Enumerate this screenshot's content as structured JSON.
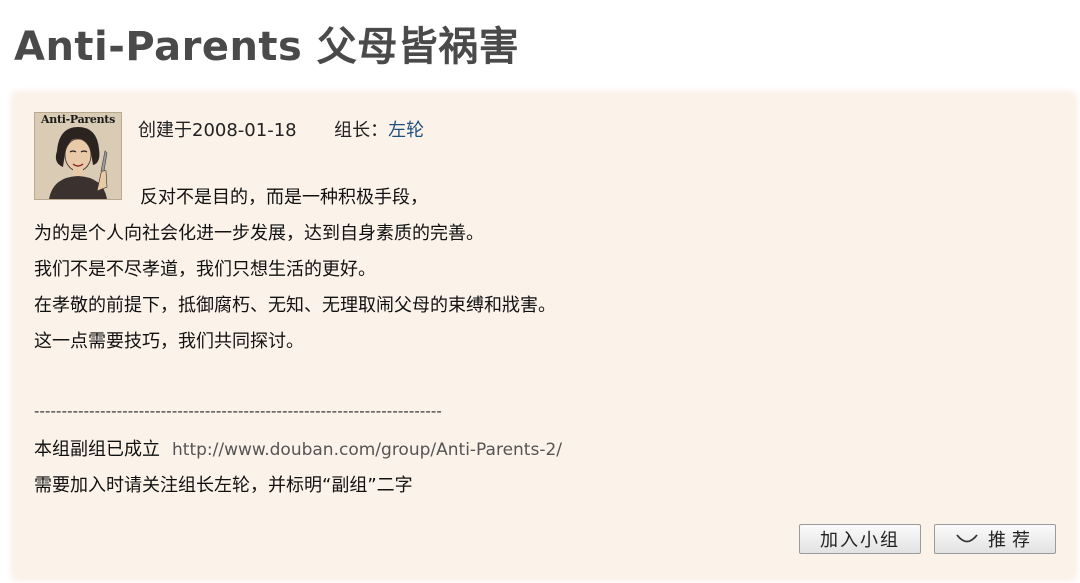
{
  "header": {
    "title": "Anti-Parents 父母皆祸害"
  },
  "group": {
    "avatar_logo": "Anti-Parents",
    "created_label": "创建于2008-01-18",
    "owner_label": "组长：",
    "owner_name": "左轮"
  },
  "intro": {
    "lines": [
      "反对不是目的，而是一种积极手段，",
      "为的是个人向社会化进一步发展，达到自身素质的完善。",
      "我们不是不尽孝道，我们只想生活的更好。",
      "在孝敬的前提下，抵御腐朽、无知、无理取闹父母的束缚和戕害。",
      "这一点需要技巧，我们共同探讨。"
    ]
  },
  "notice": {
    "divider": "--------------------------------------------------------------------------",
    "sub_group_text": "本组副组已成立",
    "sub_group_link": "http://www.douban.com/group/Anti-Parents-2/",
    "join_hint": "需要加入时请关注组长左轮，并标明“副组”二字"
  },
  "actions": {
    "join_label": "加入小组",
    "recommend_label": "推荐",
    "recommend_icon": "smile-icon"
  }
}
